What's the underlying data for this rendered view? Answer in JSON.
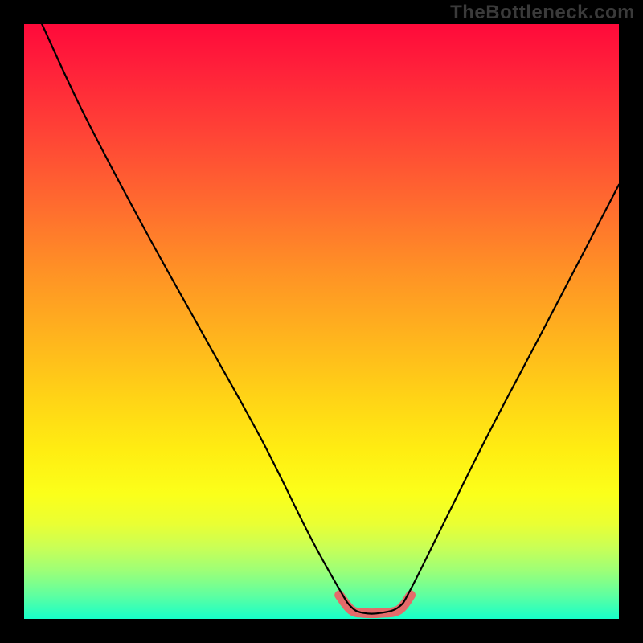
{
  "watermark": "TheBottleneck.com",
  "chart_data": {
    "type": "line",
    "title": "",
    "xlabel": "",
    "ylabel": "",
    "xlim": [
      0,
      100
    ],
    "ylim": [
      0,
      100
    ],
    "grid": false,
    "legend": false,
    "series": [
      {
        "name": "bottleneck-curve",
        "x": [
          3,
          10,
          20,
          30,
          40,
          48,
          53,
          55,
          57,
          60,
          63,
          65,
          70,
          78,
          88,
          100
        ],
        "y": [
          100,
          85,
          66,
          48,
          30,
          14,
          5,
          2,
          1,
          1,
          2,
          5,
          15,
          31,
          50,
          73
        ]
      }
    ],
    "highlight_segment": {
      "name": "optimal-range",
      "x": [
        53,
        55,
        57,
        60,
        63,
        65
      ],
      "y": [
        4,
        1.5,
        1,
        1,
        1.5,
        4
      ]
    },
    "background_gradient": {
      "top_color": "#ff0a3a",
      "mid_color": "#ffee12",
      "bottom_color": "#17ffc9"
    }
  }
}
